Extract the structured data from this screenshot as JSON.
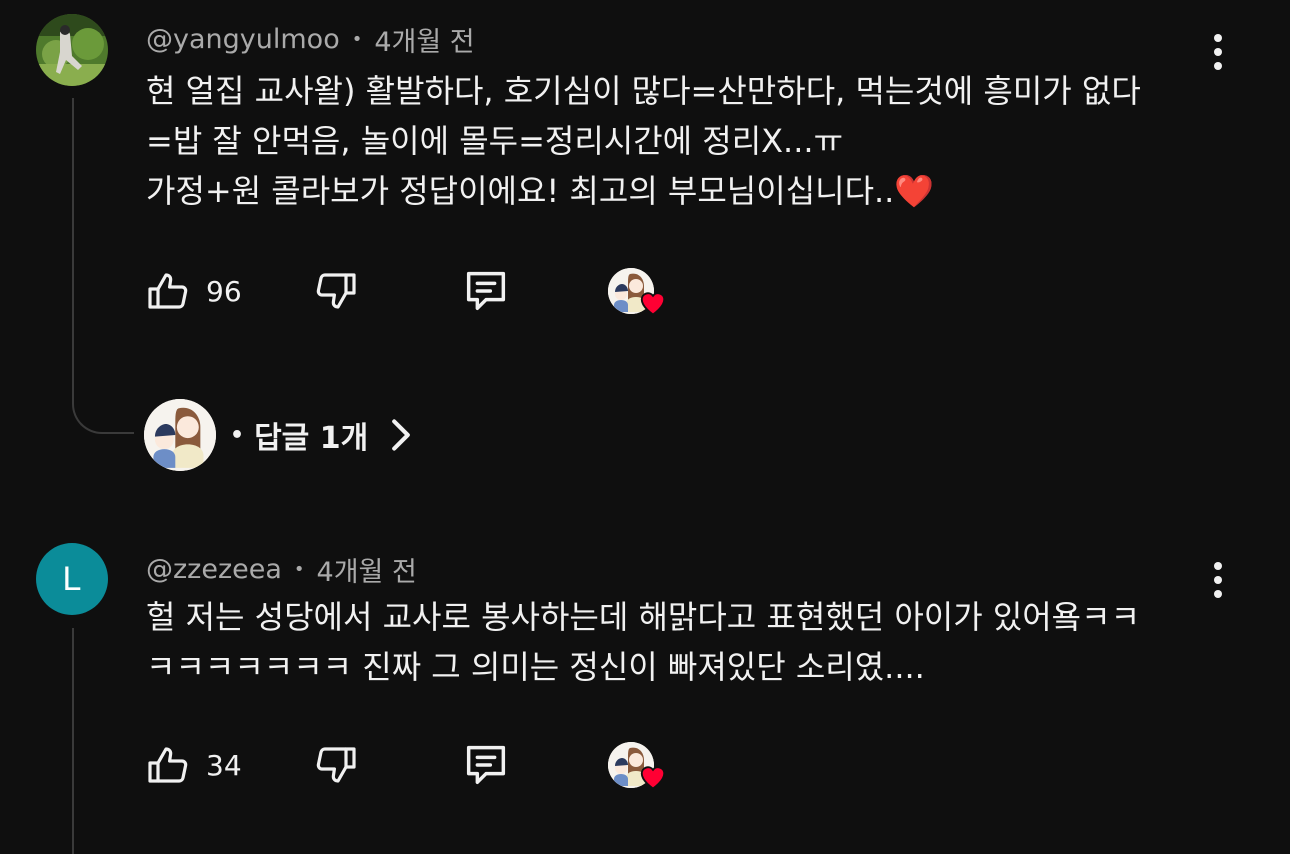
{
  "comments": [
    {
      "author": "@yangyulmoo",
      "time": "4개월 전",
      "text": "현 얼집 교사왈) 활발하다, 호기심이 많다=산만하다, 먹는것에 흥미가 없다\n=밥 잘 안먹음, 놀이에 몰두=정리시간에 정리X...ㅠ\n가정+원 콜라보가 정답이에요! 최고의 부모님이십니다..❤️",
      "likes": "96",
      "replies_label": "답글 1개"
    },
    {
      "author": "@zzezeea",
      "avatar_letter": "L",
      "avatar_color": "#0b8c99",
      "time": "4개월 전",
      "text": "헐 저는 성당에서 교사로 봉사하는데 해맑다고 표현했던 아이가 있어욬ㅋㅋ\nㅋㅋㅋㅋㅋㅋㅋ 진짜 그 의미는 정신이 빠져있단 소리였....",
      "likes": "34"
    }
  ],
  "separator": "•",
  "icons": {
    "like": "thumbs-up-icon",
    "dislike": "thumbs-down-icon",
    "reply": "comment-icon",
    "creator_heart": "creator-heart-icon",
    "more": "more-vertical-icon",
    "chevron": "chevron-right-icon"
  },
  "colors": {
    "background": "#0f0f0f",
    "text": "#f1f1f1",
    "secondary_text": "#aaaaaa",
    "heart": "#ff0033"
  }
}
